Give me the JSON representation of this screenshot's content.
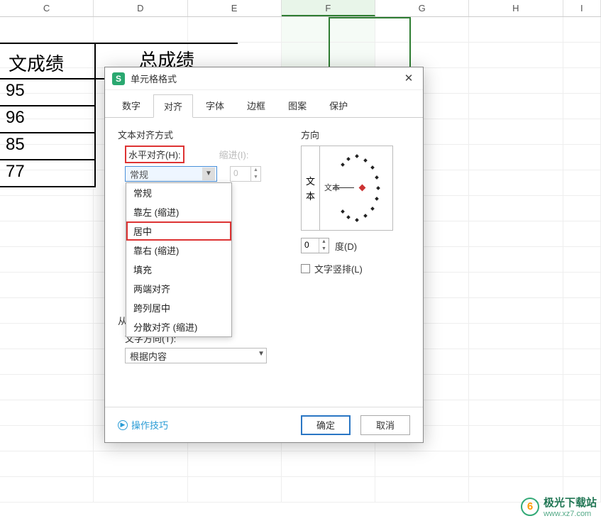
{
  "columns": [
    "C",
    "D",
    "E",
    "F",
    "G",
    "H",
    "I"
  ],
  "selected_column": "F",
  "table": {
    "header_left": "文成绩",
    "header_right": "总成绩",
    "values": [
      "95",
      "96",
      "85",
      "77"
    ]
  },
  "dialog": {
    "title": "单元格格式",
    "tabs": [
      "数字",
      "对齐",
      "字体",
      "边框",
      "图案",
      "保护"
    ],
    "active_tab": 1,
    "section_text_align": "文本对齐方式",
    "h_align_label": "水平对齐(H):",
    "h_align_value": "常规",
    "h_align_options": [
      "常规",
      "靠左 (缩进)",
      "居中",
      "靠右 (缩进)",
      "填充",
      "两端对齐",
      "跨列居中",
      "分散对齐 (缩进)"
    ],
    "indent_label": "缩进(I):",
    "indent_value": "0",
    "section_rtl": "从右到左",
    "dir_label": "文字方向(T):",
    "dir_value": "根据内容",
    "section_orient": "方向",
    "orient_vtab": "文本",
    "orient_needle": "文本",
    "degree_value": "0",
    "degree_label": "度(D)",
    "vertical_text": "文字竖排(L)",
    "tips": "操作技巧",
    "ok": "确定",
    "cancel": "取消"
  },
  "watermark": {
    "brand": "极光下载站",
    "url": "www.xz7.com",
    "glyph": "6"
  }
}
